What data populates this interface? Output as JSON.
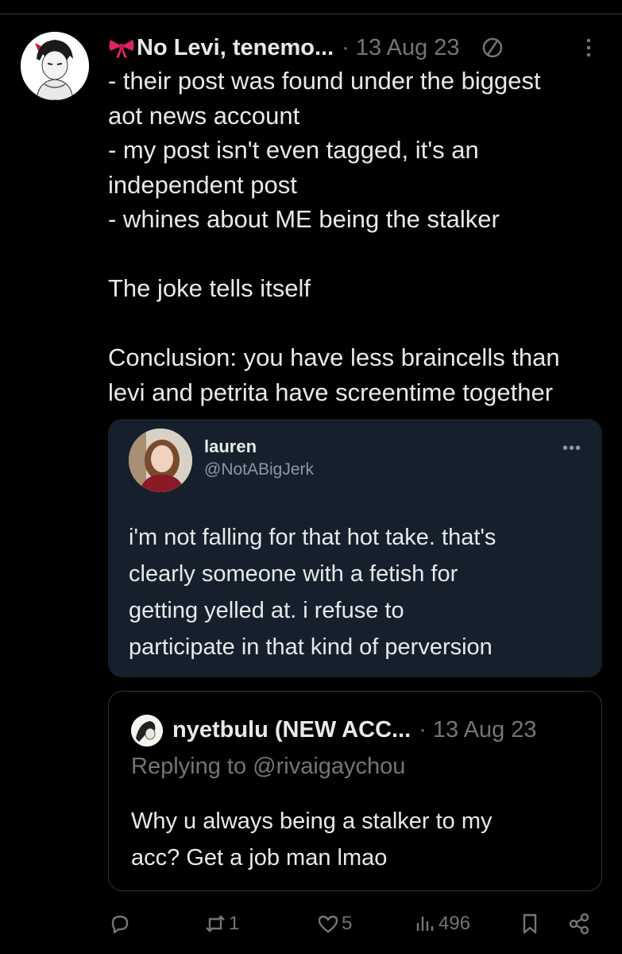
{
  "tweet": {
    "display_name": "No Levi, tenemo...",
    "meta": "· 13 Aug 23",
    "lines": [
      "- their post was found under the biggest",
      "aot news account",
      "- my post isn't even tagged, it's an",
      "independent post",
      "- whines about ME being the stalker",
      "",
      "The joke tells itself",
      "",
      "Conclusion: you have less braincells than",
      "levi and petrita have screentime together"
    ]
  },
  "quoted": {
    "name": "lauren",
    "handle": "@NotABigJerk",
    "more": "•••",
    "lines": [
      "i'm not falling for that hot take. that's",
      "clearly someone with a fetish for",
      "getting yelled at. i refuse to",
      "participate in that kind of perversion"
    ]
  },
  "reply": {
    "name": "nyetbulu (NEW ACC...",
    "date": "· 13 Aug 23",
    "replying_prefix": "Replying to ",
    "replying_handle": "@rivaigaychou",
    "lines": [
      "Why u always being a stalker to my",
      "acc? Get a job man lmao"
    ]
  },
  "actions": {
    "reply_count": "",
    "retweet_count": "1",
    "like_count": "5",
    "views_count": "496"
  },
  "colors": {
    "background": "#000000",
    "text": "#e7e9ea",
    "muted": "#71767b",
    "quote_bg": "#16202d"
  },
  "icons": [
    "ribbon-bow-icon",
    "no-entry-icon",
    "more-vertical-icon",
    "reply-icon",
    "retweet-icon",
    "heart-icon",
    "views-icon",
    "bookmark-icon",
    "share-icon"
  ]
}
